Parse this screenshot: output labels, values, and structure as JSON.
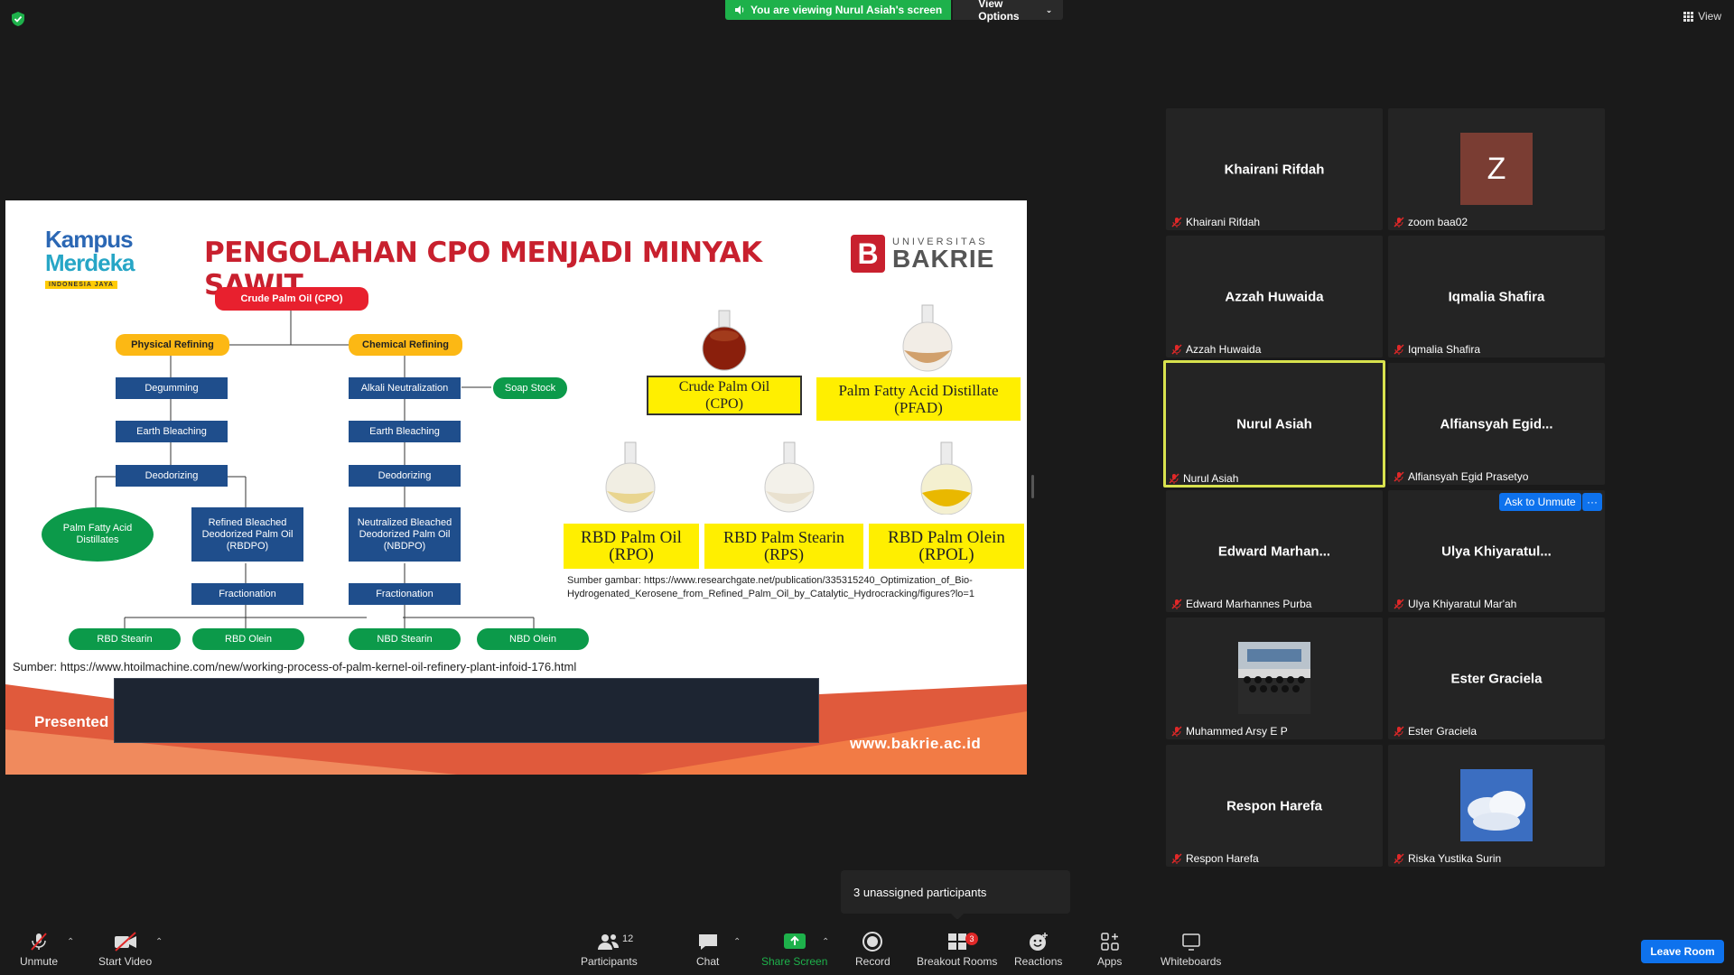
{
  "top": {
    "share_banner": "You are viewing Nurul Asiah's screen",
    "view_options": "View Options",
    "view_label": "View"
  },
  "slide": {
    "title": "PENGOLAHAN CPO MENJADI MINYAK SAWIT",
    "logo_left": {
      "line1": "Kampus",
      "line2": "Merdeka",
      "line3": "INDONESIA JAYA"
    },
    "logo_right": {
      "line1": "UNIVERSITAS",
      "line2": "BAKRIE"
    },
    "flow": {
      "cpo": "Crude Palm Oil (CPO)",
      "physical": "Physical Refining",
      "chemical": "Chemical Refining",
      "degumming": "Degumming",
      "earth1": "Earth Bleaching",
      "deodorizing1": "Deodorizing",
      "pfad": "Palm Fatty Acid Distillates",
      "rbdpo": "Refined Bleached Deodorized Palm Oil (RBDPO)",
      "fraction1": "Fractionation",
      "rbd_stearin": "RBD Stearin",
      "rbd_olein": "RBD Olein",
      "alkali": "Alkali Neutralization",
      "soap": "Soap Stock",
      "earth2": "Earth Bleaching",
      "deodorizing2": "Deodorizing",
      "nbdpo": "Neutralized Bleached Deodorized Palm Oil (NBDPO)",
      "fraction2": "Fractionation",
      "nbd_stearin": "NBD Stearin",
      "nbd_olein": "NBD Olein"
    },
    "products": {
      "cpo_a": "Crude Palm Oil",
      "cpo_b": "(CPO)",
      "pfad_a": "Palm Fatty Acid Distillate",
      "pfad_b": "(PFAD)",
      "rpo_a": "RBD Palm Oil",
      "rpo_b": "(RPO)",
      "rps_a": "RBD Palm Stearin",
      "rps_b": "(RPS)",
      "rpol_a": "RBD Palm Olein",
      "rpol_b": "(RPOL)"
    },
    "source_image": "Sumber gambar: https://www.researchgate.net/publication/335315240_Optimization_of_Bio-Hydrogenated_Kerosene_from_Refined_Palm_Oil_by_Catalytic_Hydrocracking/figures?lo=1",
    "source": "Sumber: https://www.htoilmachine.com/new/working-process-of-palm-kernel-oil-refinery-plant-infoid-176.html",
    "presented": "Presented",
    "website": "www.bakrie.ac.id"
  },
  "gallery": [
    {
      "center": "Khairani Rifdah",
      "label": "Khairani Rifdah"
    },
    {
      "center": "Z",
      "label": "zoom baa02"
    },
    {
      "center": "Azzah Huwaida",
      "label": "Azzah Huwaida"
    },
    {
      "center": "Iqmalia Shafira",
      "label": "Iqmalia Shafira"
    },
    {
      "center": "Nurul Asiah",
      "label": "Nurul Asiah"
    },
    {
      "center": "Alfiansyah  Egid...",
      "label": "Alfiansyah Egid Prasetyo"
    },
    {
      "center": "Edward  Marhan...",
      "label": "Edward Marhannes Purba"
    },
    {
      "center": "Ulya  Khiyaratul...",
      "label": "Ulya Khiyaratul Mar'ah"
    },
    {
      "center": "",
      "label": "Muhammed Arsy E P"
    },
    {
      "center": "Ester Graciela",
      "label": "Ester Graciela"
    },
    {
      "center": "Respon Harefa",
      "label": "Respon Harefa"
    },
    {
      "center": "",
      "label": "Riska Yustika Surin"
    }
  ],
  "ask_unmute": "Ask to Unmute",
  "more": "···",
  "tooltip": "3 unassigned participants",
  "toolbar": {
    "unmute": "Unmute",
    "start_video": "Start Video",
    "participants": "Participants",
    "participants_count": "12",
    "chat": "Chat",
    "share_screen": "Share Screen",
    "record": "Record",
    "breakout": "Breakout Rooms",
    "breakout_badge": "3",
    "reactions": "Reactions",
    "apps": "Apps",
    "whiteboards": "Whiteboards",
    "leave": "Leave Room"
  },
  "colors": {
    "accent_green": "#1eb14b",
    "accent_blue": "#0e72ed",
    "active_speaker": "#d8e24e",
    "slide_title_red": "#c8202e"
  }
}
